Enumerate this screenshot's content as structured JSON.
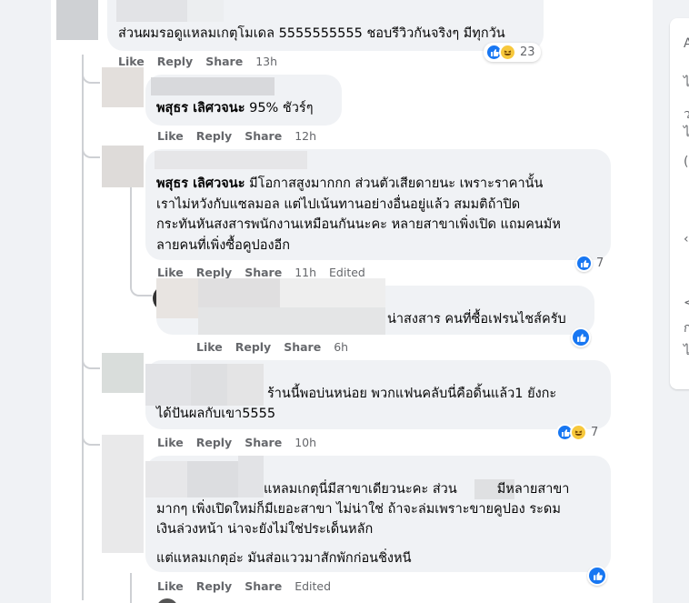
{
  "actions": {
    "like": "Like",
    "reply": "Reply",
    "share": "Share",
    "edited": "Edited"
  },
  "comments": [
    {
      "text": "ส่วนผมรอดูแหลมเกตุโมเดล 5555555555 ชอบรีวิวกันจริงๆ มีทุกวัน",
      "time": "13h",
      "reaction_count": "23"
    },
    {
      "author": "พสุธร เลิศวจนะ",
      "text": "95% ชัวร์ๆ",
      "time": "12h"
    },
    {
      "author": "พสุธร เลิศวจนะ",
      "text": "มีโอกาสสูงมากกก ส่วนตัวเสียดายนะ เพราะราคานั้น\nเราไม่หวังกับแซลมอล แต่ไปเน้นทานอย่างอื่นอยู่แล้ว สมมติถ้าปิด\nกระทันหันสงสารพนักงานเหมือนกันนะคะ หลายสาขาเพิ่งเปิด แถมคนมัห\nลายคนที่เพิ่งซื้อคูปองอีก",
      "time": "11h",
      "reaction_count": "7"
    },
    {
      "text": "น่าสงสาร คนที่ซื้อเฟรนไชส์ครับ",
      "time": "6h"
    },
    {
      "text": "ร้านนี้พอบ่นหน่อย พวกแฟนคลับนี่คือดิ้นแล้ว1 ยังกะ\nได้ปันผลกับเขา5555",
      "time": "10h",
      "reaction_count": "7"
    },
    {
      "text_line1a": "แหลมเกตุนี่มีสาขาเดียวนะคะ ส่วน",
      "text_line1b": "มีหลายสาขา",
      "text_rest": "มากๆ เพิ่งเปิดใหม่ก็มีเยอะสาขา ไม่น่าใช่ ถ้าจะล่มเพราะขายคูปอง ระดม\nเงินล่วงหน้า น่าจะยังไม่ใช่ประเด็นหลัก",
      "text_para2": "แต่แหลมเกตุอ่ะ มันส่อแววมาสักพักก่อนชิ่งหนี"
    }
  ],
  "colors": {
    "like_blue": "#1877f2",
    "haha_yellow": "#f7c83c",
    "bubble_bg": "#f0f2f5",
    "meta_gray": "#65676b"
  },
  "icons": [
    "like-reaction-icon",
    "haha-reaction-icon"
  ],
  "sidebar_glyphs": [
    "A",
    "ไ",
    "ว",
    "ไ",
    "(",
    "‹",
    "<",
    "ก",
    "ไ"
  ]
}
